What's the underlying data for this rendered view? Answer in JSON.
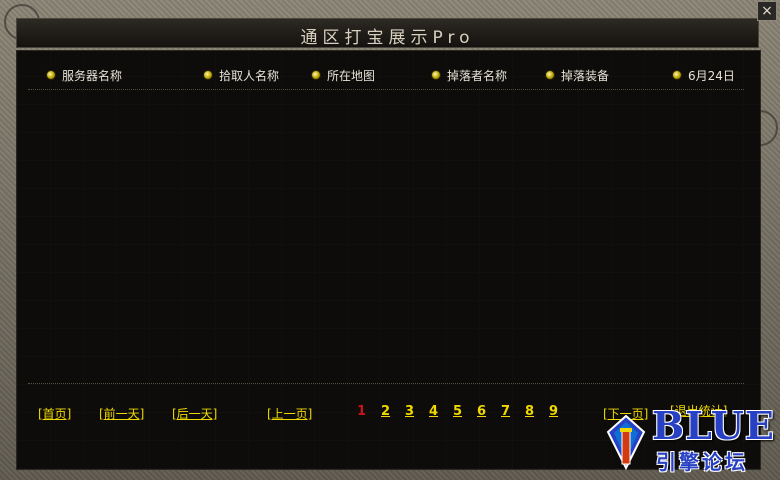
{
  "window": {
    "title": "通区打宝展示Pro",
    "close_glyph": "×"
  },
  "columns": [
    {
      "label": "服务器名称"
    },
    {
      "label": "拾取人名称"
    },
    {
      "label": "所在地图"
    },
    {
      "label": "掉落者名称"
    },
    {
      "label": "掉落装备"
    },
    {
      "label": "6月24日"
    }
  ],
  "nav": {
    "first_page": "[首页]",
    "prev_day": "[前一天]",
    "next_day": "[后一天]",
    "prev_page": "[上一页]",
    "next_page": "[下一页]",
    "exit": "[退出统计]"
  },
  "pages": [
    "1",
    "2",
    "3",
    "4",
    "5",
    "6",
    "7",
    "8",
    "9"
  ],
  "current_page": "1",
  "logo": {
    "name": "BLUE",
    "sub": "引擎论坛"
  },
  "colors": {
    "link": "#f0d800",
    "current_page": "#c8141b",
    "header_text": "#e6e2d6",
    "logo": "#2740c4"
  }
}
